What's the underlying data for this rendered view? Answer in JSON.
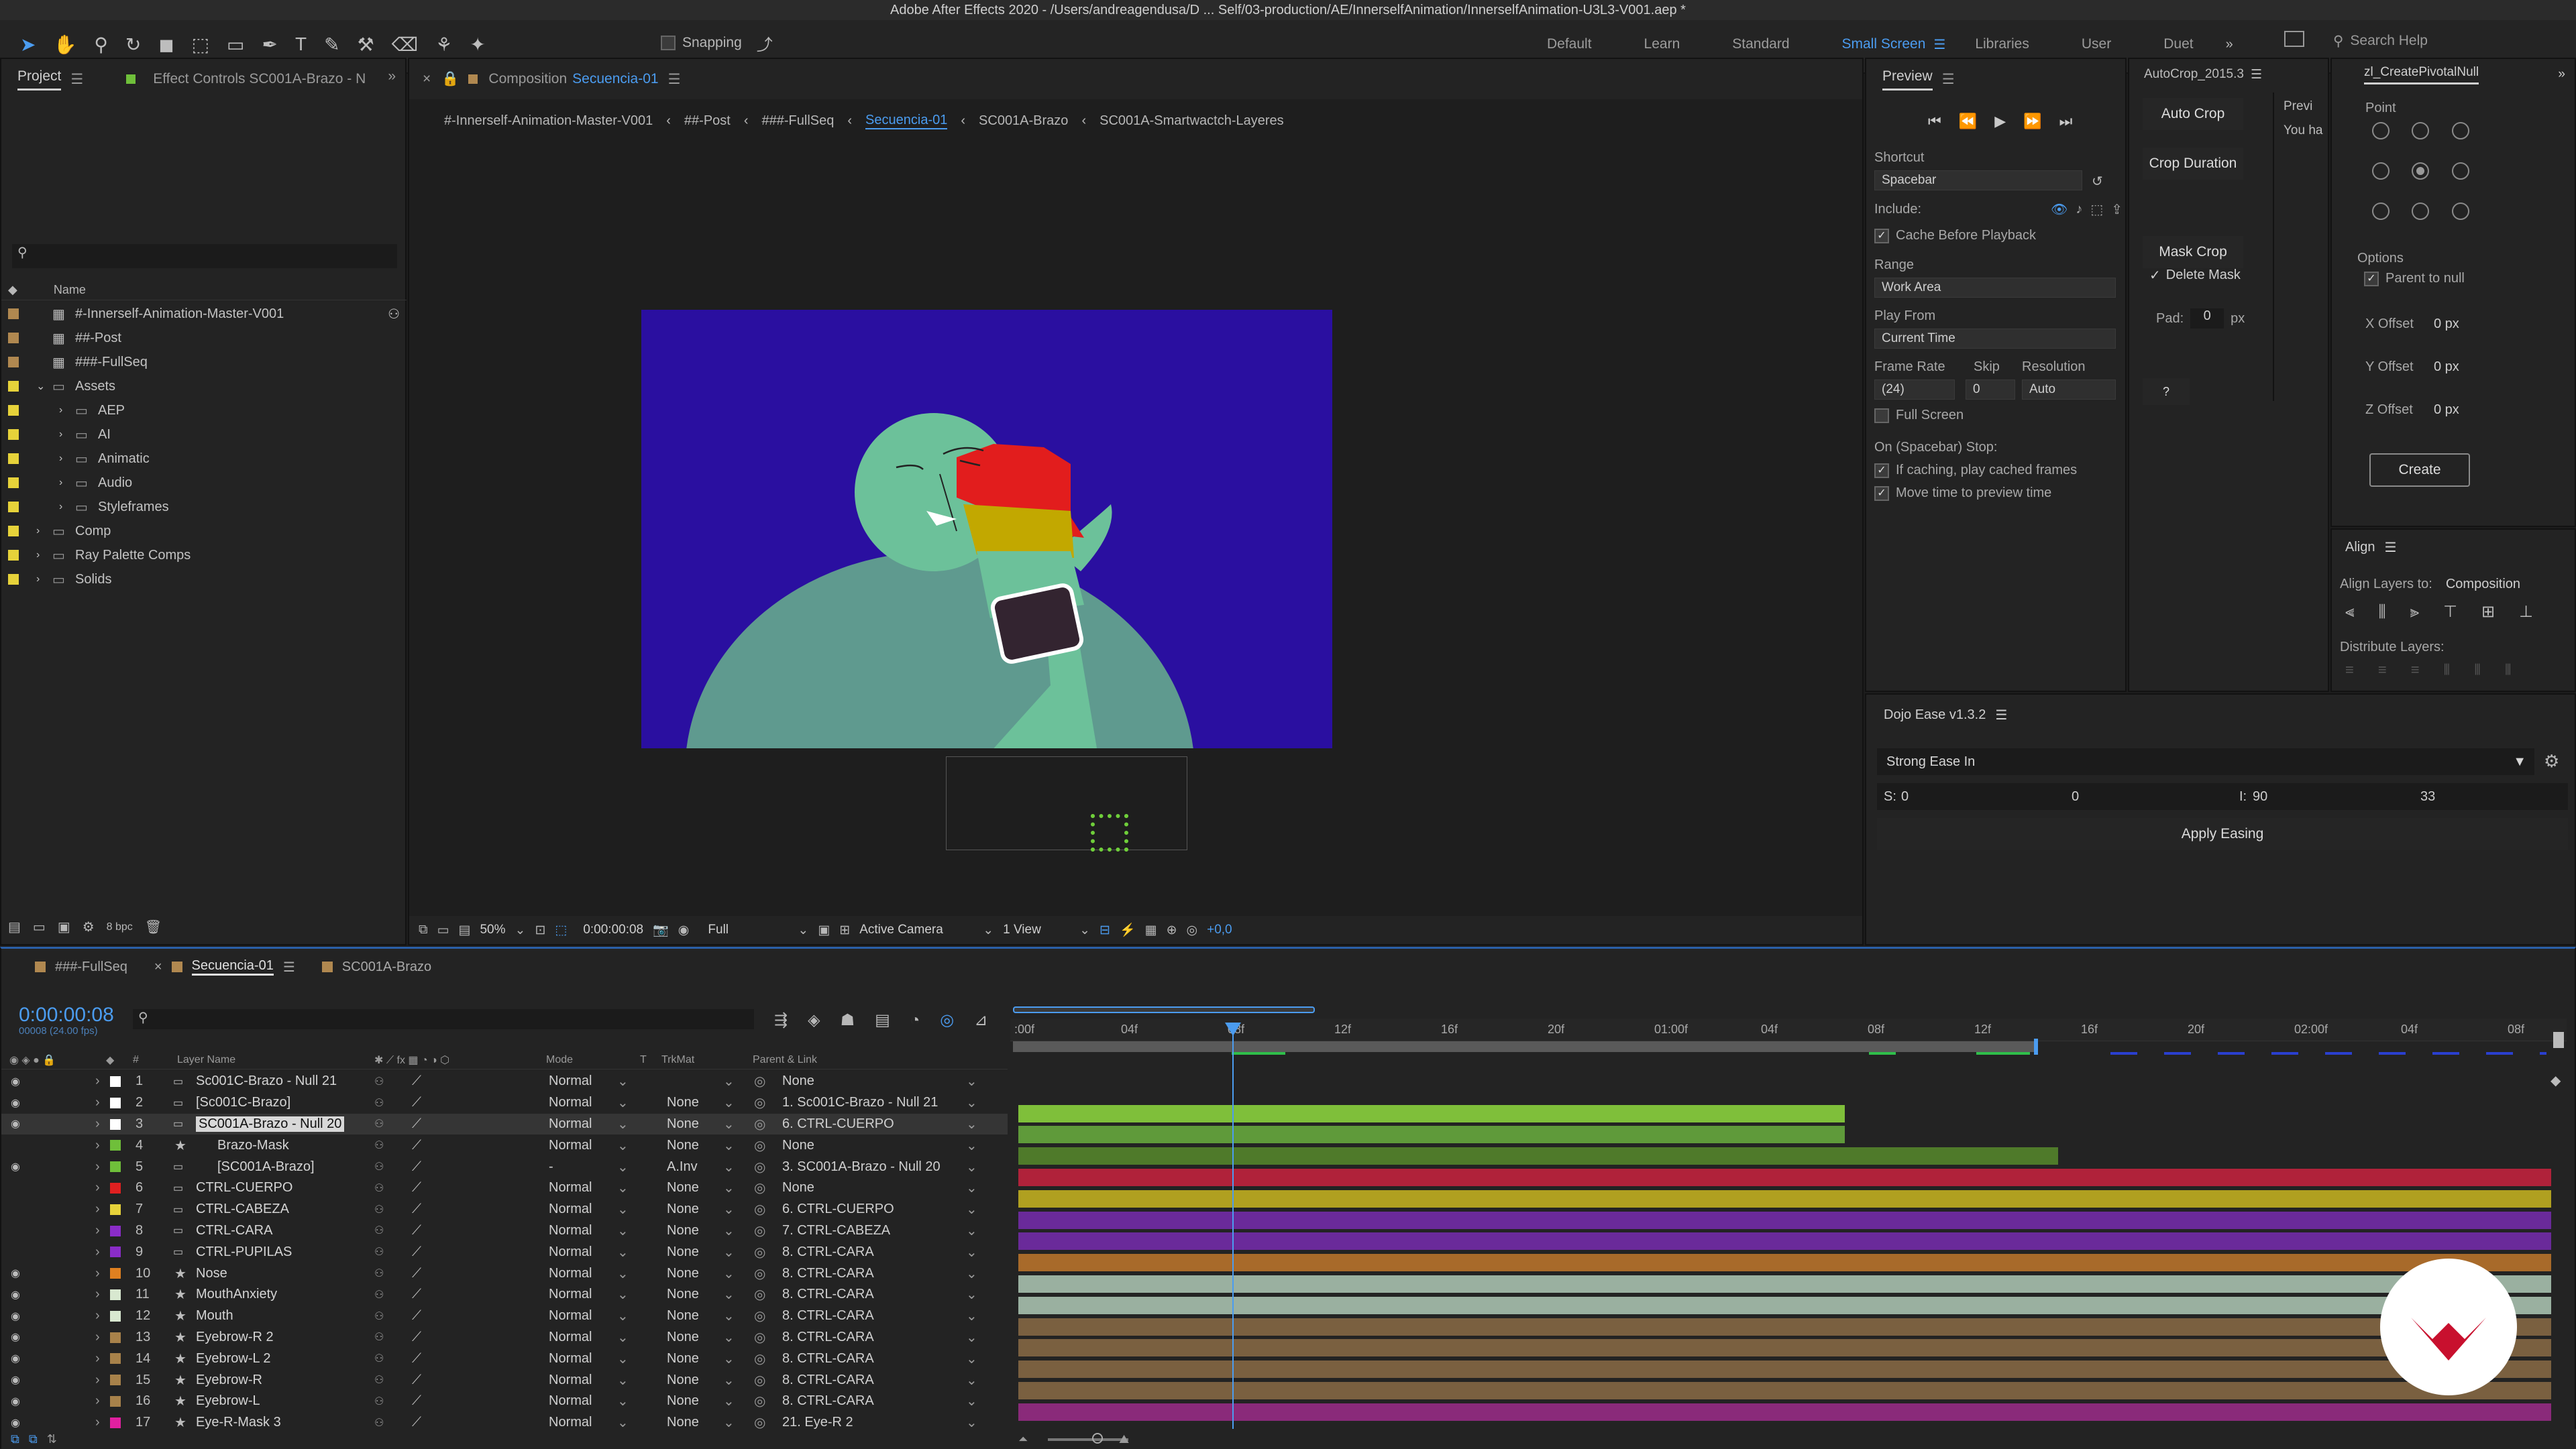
{
  "window": {
    "title": "Adobe After Effects 2020 - /Users/andreagendusa/D ... Self/03-production/AE/InnerselfAnimation/InnerselfAnimation-U3L3-V001.aep *"
  },
  "toolbar": {
    "snapping": "Snapping",
    "workspaces": [
      "Default",
      "Learn",
      "Standard",
      "Small Screen",
      "Libraries",
      "User",
      "Duet"
    ],
    "active_workspace": "Small Screen",
    "search_placeholder": "Search Help"
  },
  "project_panel": {
    "tab_project": "Project",
    "tab_effects": "Effect Controls SC001A-Brazo - N",
    "col_name": "Name",
    "bpc": "8 bpc",
    "items": [
      {
        "name": "#-Innerself-Animation-Master-V001",
        "color": "#b08850",
        "indent": 0,
        "kind": "comp"
      },
      {
        "name": "##-Post",
        "color": "#b08850",
        "indent": 0,
        "kind": "comp"
      },
      {
        "name": "###-FullSeq",
        "color": "#b08850",
        "indent": 0,
        "kind": "comp"
      },
      {
        "name": "Assets",
        "color": "#e6d23a",
        "indent": 0,
        "kind": "folder-open"
      },
      {
        "name": "AEP",
        "color": "#e6d23a",
        "indent": 1,
        "kind": "folder"
      },
      {
        "name": "AI",
        "color": "#e6d23a",
        "indent": 1,
        "kind": "folder"
      },
      {
        "name": "Animatic",
        "color": "#e6d23a",
        "indent": 1,
        "kind": "folder"
      },
      {
        "name": "Audio",
        "color": "#e6d23a",
        "indent": 1,
        "kind": "folder"
      },
      {
        "name": "Styleframes",
        "color": "#e6d23a",
        "indent": 1,
        "kind": "folder"
      },
      {
        "name": "Comp",
        "color": "#e6d23a",
        "indent": 0,
        "kind": "folder"
      },
      {
        "name": "Ray Palette Comps",
        "color": "#e6d23a",
        "indent": 0,
        "kind": "folder"
      },
      {
        "name": "Solids",
        "color": "#e6d23a",
        "indent": 0,
        "kind": "folder"
      }
    ]
  },
  "composition": {
    "tab_prefix": "Composition",
    "tab_name": "Secuencia-01",
    "breadcrumbs": [
      "#-Innerself-Animation-Master-V001",
      "##-Post",
      "###-FullSeq",
      "Secuencia-01",
      "SC001A-Brazo",
      "SC001A-Smartwactch-Layeres"
    ],
    "active_crumb": "Secuencia-01",
    "footer": {
      "zoom": "50%",
      "timecode": "0:00:00:08",
      "resolution": "Full",
      "camera": "Active Camera",
      "views": "1 View",
      "exposure": "+0,0"
    },
    "canvas_bg": "#2a0fa0",
    "face_color": "#6cc19a",
    "body_color": "#5f9a8f"
  },
  "preview": {
    "title": "Preview",
    "shortcut_label": "Shortcut",
    "shortcut": "Spacebar",
    "include_label": "Include:",
    "cache_before": "Cache Before Playback",
    "range_label": "Range",
    "range": "Work Area",
    "play_from_label": "Play From",
    "play_from": "Current Time",
    "framerate_label": "Frame Rate",
    "skip_label": "Skip",
    "resolution_label": "Resolution",
    "framerate": "(24)",
    "skip": "0",
    "resolution": "Auto",
    "full_screen": "Full Screen",
    "stop_label": "On (Spacebar) Stop:",
    "if_caching": "If caching, play cached frames",
    "move_time": "Move time to preview time"
  },
  "autocrop": {
    "title": "AutoCrop_2015.3",
    "auto_crop": "Auto Crop",
    "crop_duration": "Crop Duration",
    "mask_crop": "Mask Crop",
    "delete_mask": "Delete Mask",
    "pad_label": "Pad:",
    "pad_value": "0",
    "pad_unit": "px",
    "help": "?",
    "preview_partial": "Previ",
    "you_have_partial": "You ha"
  },
  "pivot": {
    "title": "zl_CreatePivotalNull",
    "point_label": "Point",
    "options_label": "Options",
    "parent_to_null": "Parent to null",
    "x_offset_label": "X Offset",
    "y_offset_label": "Y Offset",
    "z_offset_label": "Z Offset",
    "x_offset": "0 px",
    "y_offset": "0 px",
    "z_offset": "0 px",
    "create": "Create"
  },
  "align": {
    "title": "Align",
    "align_to_label": "Align Layers to:",
    "align_to": "Composition",
    "distribute_label": "Distribute Layers:"
  },
  "dojo": {
    "title": "Dojo Ease v1.3.2",
    "preset": "Strong Ease In",
    "s_label": "S:",
    "i_label": "I:",
    "s1": "0",
    "s2": "0",
    "i1": "90",
    "i2": "33",
    "apply": "Apply Easing"
  },
  "timeline": {
    "tabs": [
      "###-FullSeq",
      "Secuencia-01",
      "SC001A-Brazo"
    ],
    "active_tab": "Secuencia-01",
    "timecode": "0:00:00:08",
    "timecode_sub": "00008 (24.00 fps)",
    "col_layer_name": "Layer Name",
    "col_mode": "Mode",
    "col_t": "T",
    "col_trkmat": "TrkMat",
    "col_parent": "Parent & Link",
    "ruler": [
      ":00f",
      "04f",
      "08f",
      "12f",
      "16f",
      "20f",
      "01:00f",
      "04f",
      "08f",
      "12f",
      "16f",
      "20f",
      "02:00f",
      "04f",
      "08f"
    ],
    "layers": [
      {
        "num": "1",
        "name": "Sc001C-Brazo - Null 21",
        "color": "#ffffff",
        "mode": "Normal",
        "trk": "",
        "parent": "None",
        "eye": true,
        "star": false
      },
      {
        "num": "2",
        "name": "[Sc001C-Brazo]",
        "color": "#ffffff",
        "mode": "Normal",
        "trk": "None",
        "parent": "1. Sc001C-Brazo - Null 21",
        "eye": true,
        "star": false
      },
      {
        "num": "3",
        "name": "SC001A-Brazo - Null 20",
        "color": "#ffffff",
        "mode": "Normal",
        "trk": "None",
        "parent": "6. CTRL-CUERPO",
        "eye": true,
        "star": false
      },
      {
        "num": "4",
        "name": "Brazo-Mask",
        "color": "#6fbf3a",
        "mode": "Normal",
        "trk": "None",
        "parent": "None",
        "eye": false,
        "star": true
      },
      {
        "num": "5",
        "name": "[SC001A-Brazo]",
        "color": "#6fbf3a",
        "mode": "-",
        "trk": "A.Inv",
        "parent": "3. SC001A-Brazo - Null 20",
        "eye": true,
        "star": false
      },
      {
        "num": "6",
        "name": "CTRL-CUERPO",
        "color": "#e02020",
        "mode": "Normal",
        "trk": "None",
        "parent": "None",
        "eye": false,
        "star": false
      },
      {
        "num": "7",
        "name": "CTRL-CABEZA",
        "color": "#e6d23a",
        "mode": "Normal",
        "trk": "None",
        "parent": "6. CTRL-CUERPO",
        "eye": false,
        "star": false
      },
      {
        "num": "8",
        "name": "CTRL-CARA",
        "color": "#8a2cc8",
        "mode": "Normal",
        "trk": "None",
        "parent": "7. CTRL-CABEZA",
        "eye": false,
        "star": false
      },
      {
        "num": "9",
        "name": "CTRL-PUPILAS",
        "color": "#8a2cc8",
        "mode": "Normal",
        "trk": "None",
        "parent": "8. CTRL-CARA",
        "eye": false,
        "star": false
      },
      {
        "num": "10",
        "name": "Nose",
        "color": "#e08020",
        "mode": "Normal",
        "trk": "None",
        "parent": "8. CTRL-CARA",
        "eye": true,
        "star": true
      },
      {
        "num": "11",
        "name": "MouthAnxiety",
        "color": "#d8e8d0",
        "mode": "Normal",
        "trk": "None",
        "parent": "8. CTRL-CARA",
        "eye": true,
        "star": true
      },
      {
        "num": "12",
        "name": "Mouth",
        "color": "#d8e8d0",
        "mode": "Normal",
        "trk": "None",
        "parent": "8. CTRL-CARA",
        "eye": true,
        "star": true
      },
      {
        "num": "13",
        "name": "Eyebrow-R 2",
        "color": "#a8824a",
        "mode": "Normal",
        "trk": "None",
        "parent": "8. CTRL-CARA",
        "eye": true,
        "star": true
      },
      {
        "num": "14",
        "name": "Eyebrow-L 2",
        "color": "#a8824a",
        "mode": "Normal",
        "trk": "None",
        "parent": "8. CTRL-CARA",
        "eye": true,
        "star": true
      },
      {
        "num": "15",
        "name": "Eyebrow-R",
        "color": "#a8824a",
        "mode": "Normal",
        "trk": "None",
        "parent": "8. CTRL-CARA",
        "eye": true,
        "star": true
      },
      {
        "num": "16",
        "name": "Eyebrow-L",
        "color": "#a8824a",
        "mode": "Normal",
        "trk": "None",
        "parent": "8. CTRL-CARA",
        "eye": true,
        "star": true
      },
      {
        "num": "17",
        "name": "Eye-R-Mask 3",
        "color": "#e020a0",
        "mode": "Normal",
        "trk": "None",
        "parent": "21. Eye-R 2",
        "eye": true,
        "star": true
      }
    ]
  }
}
